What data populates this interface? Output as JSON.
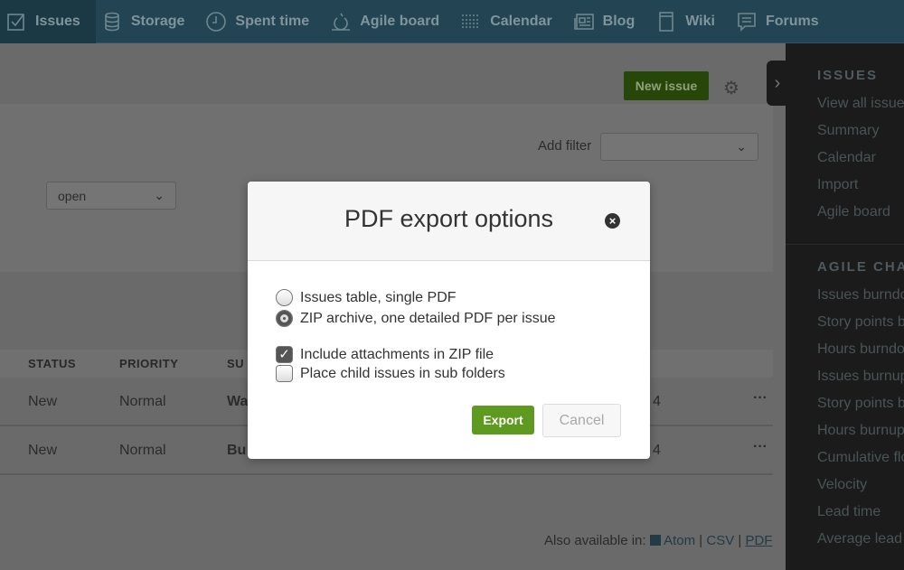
{
  "nav": [
    {
      "label": "Issues",
      "icon": "checkbox-icon",
      "active": true
    },
    {
      "label": "Storage",
      "icon": "database-icon"
    },
    {
      "label": "Spent time",
      "icon": "clock-icon"
    },
    {
      "label": "Agile board",
      "icon": "agile-icon"
    },
    {
      "label": "Calendar",
      "icon": "calendar-icon"
    },
    {
      "label": "Blog",
      "icon": "newspaper-icon"
    },
    {
      "label": "Wiki",
      "icon": "book-icon"
    },
    {
      "label": "Forums",
      "icon": "chat-icon"
    }
  ],
  "toolbar": {
    "new_issue": "New issue"
  },
  "filters": {
    "add_filter_label": "Add filter",
    "add_filter_value": "",
    "status_value": "open"
  },
  "table": {
    "headers": [
      "STATUS",
      "PRIORITY",
      "SU"
    ],
    "rows": [
      {
        "status": "New",
        "priority": "Normal",
        "subject": "Wa",
        "extra": "4"
      },
      {
        "status": "New",
        "priority": "Normal",
        "subject": "Bu",
        "extra": "4"
      }
    ]
  },
  "also": {
    "label": "Also available in:",
    "atom": "Atom",
    "csv": "CSV",
    "pdf": "PDF",
    "sep": "|"
  },
  "sidebar": {
    "issues_heading": "ISSUES",
    "issues": [
      "View all issues",
      "Summary",
      "Calendar",
      "Import",
      "Agile board"
    ],
    "agile_heading": "AGILE CHARTS",
    "charts": [
      "Issues burndown",
      "Story points burndown",
      "Hours burndown",
      "Issues burnup",
      "Story points burnup",
      "Hours burnup",
      "Cumulative flow",
      "Velocity",
      "Lead time",
      "Average lead time"
    ]
  },
  "modal": {
    "title": "PDF export options",
    "options": [
      {
        "label": "Issues table, single PDF",
        "type": "radio",
        "checked": false
      },
      {
        "label": "ZIP archive, one detailed PDF per issue",
        "type": "radio",
        "checked": true
      },
      {
        "label": "Include attachments in ZIP file",
        "type": "checkbox",
        "checked": true
      },
      {
        "label": "Place child issues in sub folders",
        "type": "checkbox",
        "checked": false
      }
    ],
    "export": "Export",
    "cancel": "Cancel"
  },
  "colors": {
    "accent": "#5e9a20",
    "nav": "#234452"
  }
}
